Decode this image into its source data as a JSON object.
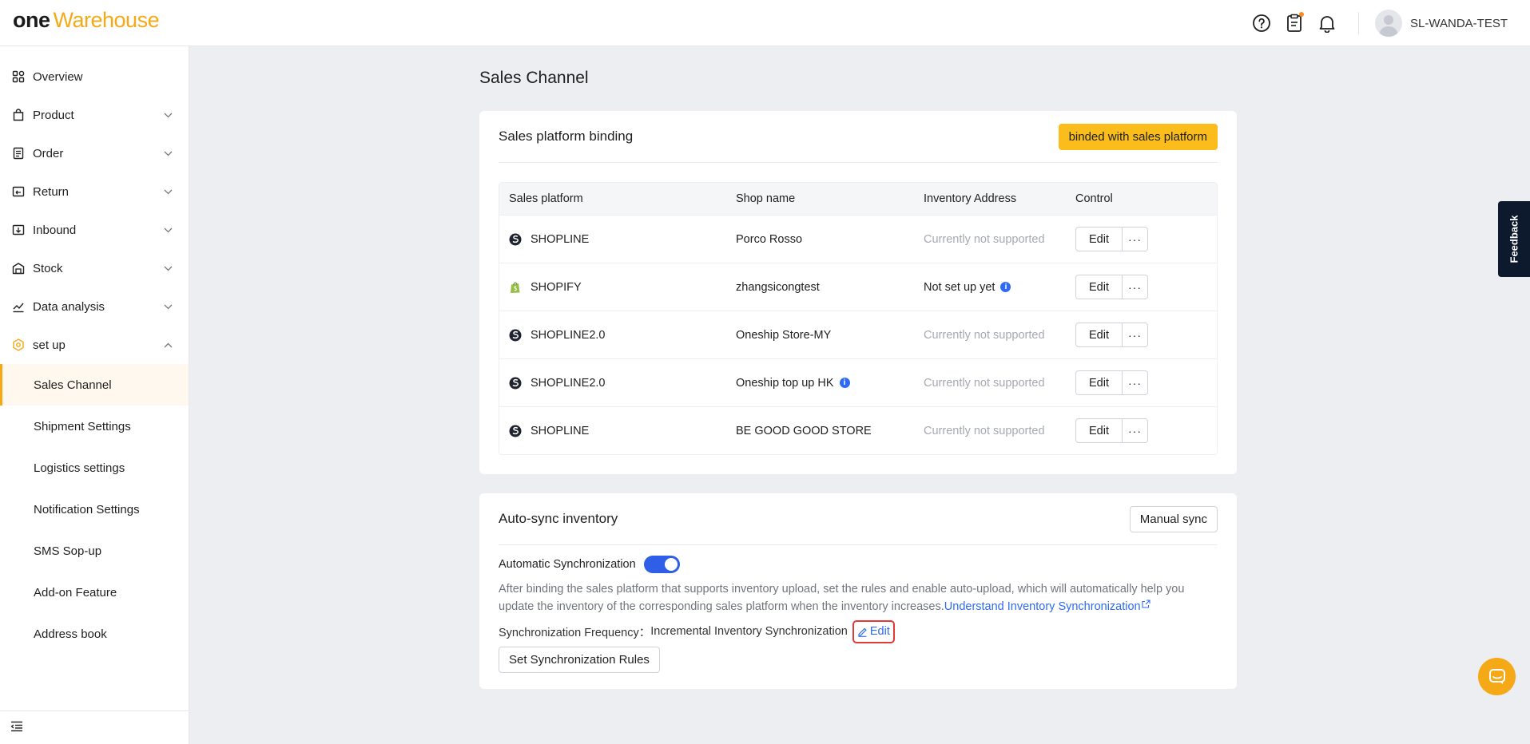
{
  "header": {
    "logo_one": "one",
    "logo_warehouse": "Warehouse",
    "user_name": "SL-WANDA-TEST"
  },
  "sidebar": {
    "items": [
      {
        "label": "Overview",
        "icon": "overview-icon"
      },
      {
        "label": "Product",
        "icon": "product-icon"
      },
      {
        "label": "Order",
        "icon": "order-icon"
      },
      {
        "label": "Return",
        "icon": "return-icon"
      },
      {
        "label": "Inbound",
        "icon": "inbound-icon"
      },
      {
        "label": "Stock",
        "icon": "stock-icon"
      },
      {
        "label": "Data analysis",
        "icon": "data-analysis-icon"
      },
      {
        "label": "set up",
        "icon": "setup-icon"
      }
    ],
    "sub_items": [
      {
        "label": "Sales Channel",
        "active": true
      },
      {
        "label": "Shipment Settings"
      },
      {
        "label": "Logistics settings"
      },
      {
        "label": "Notification Settings"
      },
      {
        "label": "SMS Sop-up"
      },
      {
        "label": "Add-on Feature"
      },
      {
        "label": "Address book"
      }
    ]
  },
  "main": {
    "page_title": "Sales Channel",
    "binding": {
      "title": "Sales platform binding",
      "bind_button": "binded with sales platform",
      "columns": [
        "Sales platform",
        "Shop name",
        "Inventory Address",
        "Control"
      ],
      "rows": [
        {
          "platform": "SHOPLINE",
          "shop": "Porco Rosso",
          "address": "Currently not supported",
          "edit": "Edit",
          "more": "···"
        },
        {
          "platform": "SHOPIFY",
          "shop": "zhangsicongtest",
          "address": "Not set up yet",
          "edit": "Edit",
          "more": "···"
        },
        {
          "platform": "SHOPLINE2.0",
          "shop": "Oneship Store-MY",
          "address": "Currently not supported",
          "edit": "Edit",
          "more": "···"
        },
        {
          "platform": "SHOPLINE2.0",
          "shop": "Oneship top up HK",
          "address": "Currently not supported",
          "edit": "Edit",
          "more": "···"
        },
        {
          "platform": "SHOPLINE",
          "shop": "BE GOOD GOOD STORE",
          "address": "Currently not supported",
          "edit": "Edit",
          "more": "···"
        }
      ]
    },
    "sync": {
      "title": "Auto-sync inventory",
      "manual_button": "Manual sync",
      "auto_label": "Automatic Synchronization",
      "auto_enabled": true,
      "description": "After binding the sales platform that supports inventory upload, set the rules and enable auto-upload, which will automatically help you update the inventory of the corresponding sales platform when the inventory increases.",
      "link_text": "Understand Inventory Synchronization",
      "frequency_label": "Synchronization Frequency：",
      "frequency_value": "Incremental Inventory Synchronization",
      "frequency_edit": "Edit",
      "rules_button": "Set Synchronization Rules"
    }
  },
  "feedback_label": "Feedback",
  "colors": {
    "brand": "#f6a916",
    "primary": "#2f6bf2",
    "button_yellow": "#fbbd1c",
    "highlight": "#e53935"
  }
}
